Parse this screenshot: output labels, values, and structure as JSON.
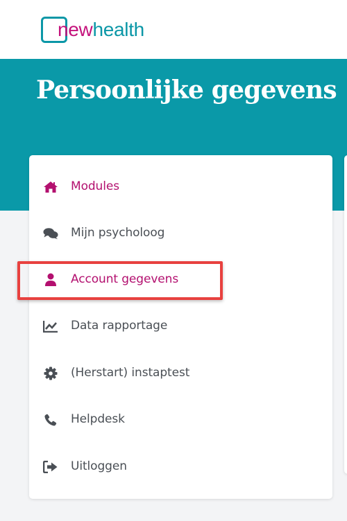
{
  "logo": {
    "part1": "new",
    "part2": "health"
  },
  "hero": {
    "title": "Persoonlijke gegevens"
  },
  "menu": {
    "items": [
      {
        "label": "Modules",
        "icon": "home-icon",
        "active": true
      },
      {
        "label": "Mijn psycholoog",
        "icon": "chat-icon",
        "active": false
      },
      {
        "label": "Account gegevens",
        "icon": "user-icon",
        "active": true
      },
      {
        "label": "Data rapportage",
        "icon": "chart-icon",
        "active": false
      },
      {
        "label": "(Herstart) instaptest",
        "icon": "gear-icon",
        "active": false
      },
      {
        "label": "Helpdesk",
        "icon": "phone-icon",
        "active": false
      },
      {
        "label": "Uitloggen",
        "icon": "logout-icon",
        "active": false
      }
    ]
  },
  "colors": {
    "teal": "#0a99a8",
    "magenta": "#b3106f",
    "highlight": "#e8413f",
    "icon_gray": "#4a4f55"
  }
}
